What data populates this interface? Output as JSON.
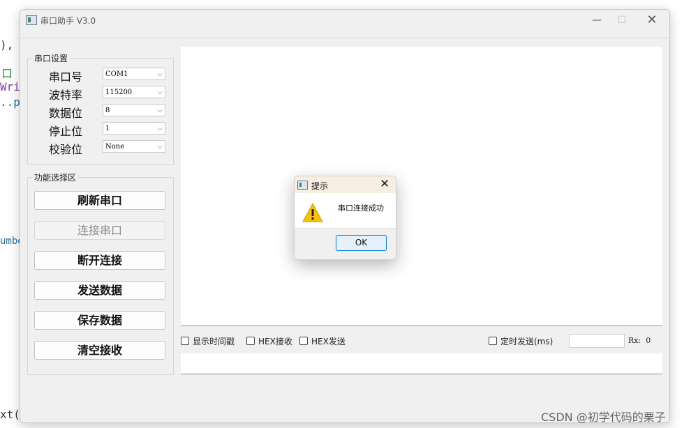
{
  "bg_editor": {
    "line1": "), C",
    "line2": "口",
    "line3": "Writ",
    "line4": "..po",
    "line5": "umbe",
    "line6": "xt()"
  },
  "window": {
    "title": "串口助手 V3.0",
    "min_icon": "minimize-icon",
    "max_icon": "maximize-icon",
    "close_icon": "close-icon"
  },
  "serial_settings": {
    "title": "串口设置",
    "fields": [
      {
        "label": "串口号",
        "value": "COM1"
      },
      {
        "label": "波特率",
        "value": "115200"
      },
      {
        "label": "数据位",
        "value": "8"
      },
      {
        "label": "停止位",
        "value": "1"
      },
      {
        "label": "校验位",
        "value": "None"
      }
    ]
  },
  "functions": {
    "title": "功能选择区",
    "buttons": [
      {
        "label": "刷新串口",
        "enabled": true
      },
      {
        "label": "连接串口",
        "enabled": false
      },
      {
        "label": "断开连接",
        "enabled": true
      },
      {
        "label": "发送数据",
        "enabled": true
      },
      {
        "label": "保存数据",
        "enabled": true
      },
      {
        "label": "清空接收",
        "enabled": true
      }
    ]
  },
  "options": {
    "show_timestamp": "显示时间戳",
    "hex_receive": "HEX接收",
    "hex_send": "HEX发送",
    "timed_send": "定时发送(ms)",
    "timer_value": "",
    "rx_label": "Rx:",
    "rx_count": "0"
  },
  "dialog": {
    "title": "提示",
    "message": "串口连接成功",
    "ok_label": "OK",
    "icon": "warning-icon"
  },
  "watermark": "CSDN @初学代码的栗子",
  "colors": {
    "accent": "#0078d4",
    "warning": "#f5c211",
    "dialog_title_bg": "#f7efe2"
  }
}
